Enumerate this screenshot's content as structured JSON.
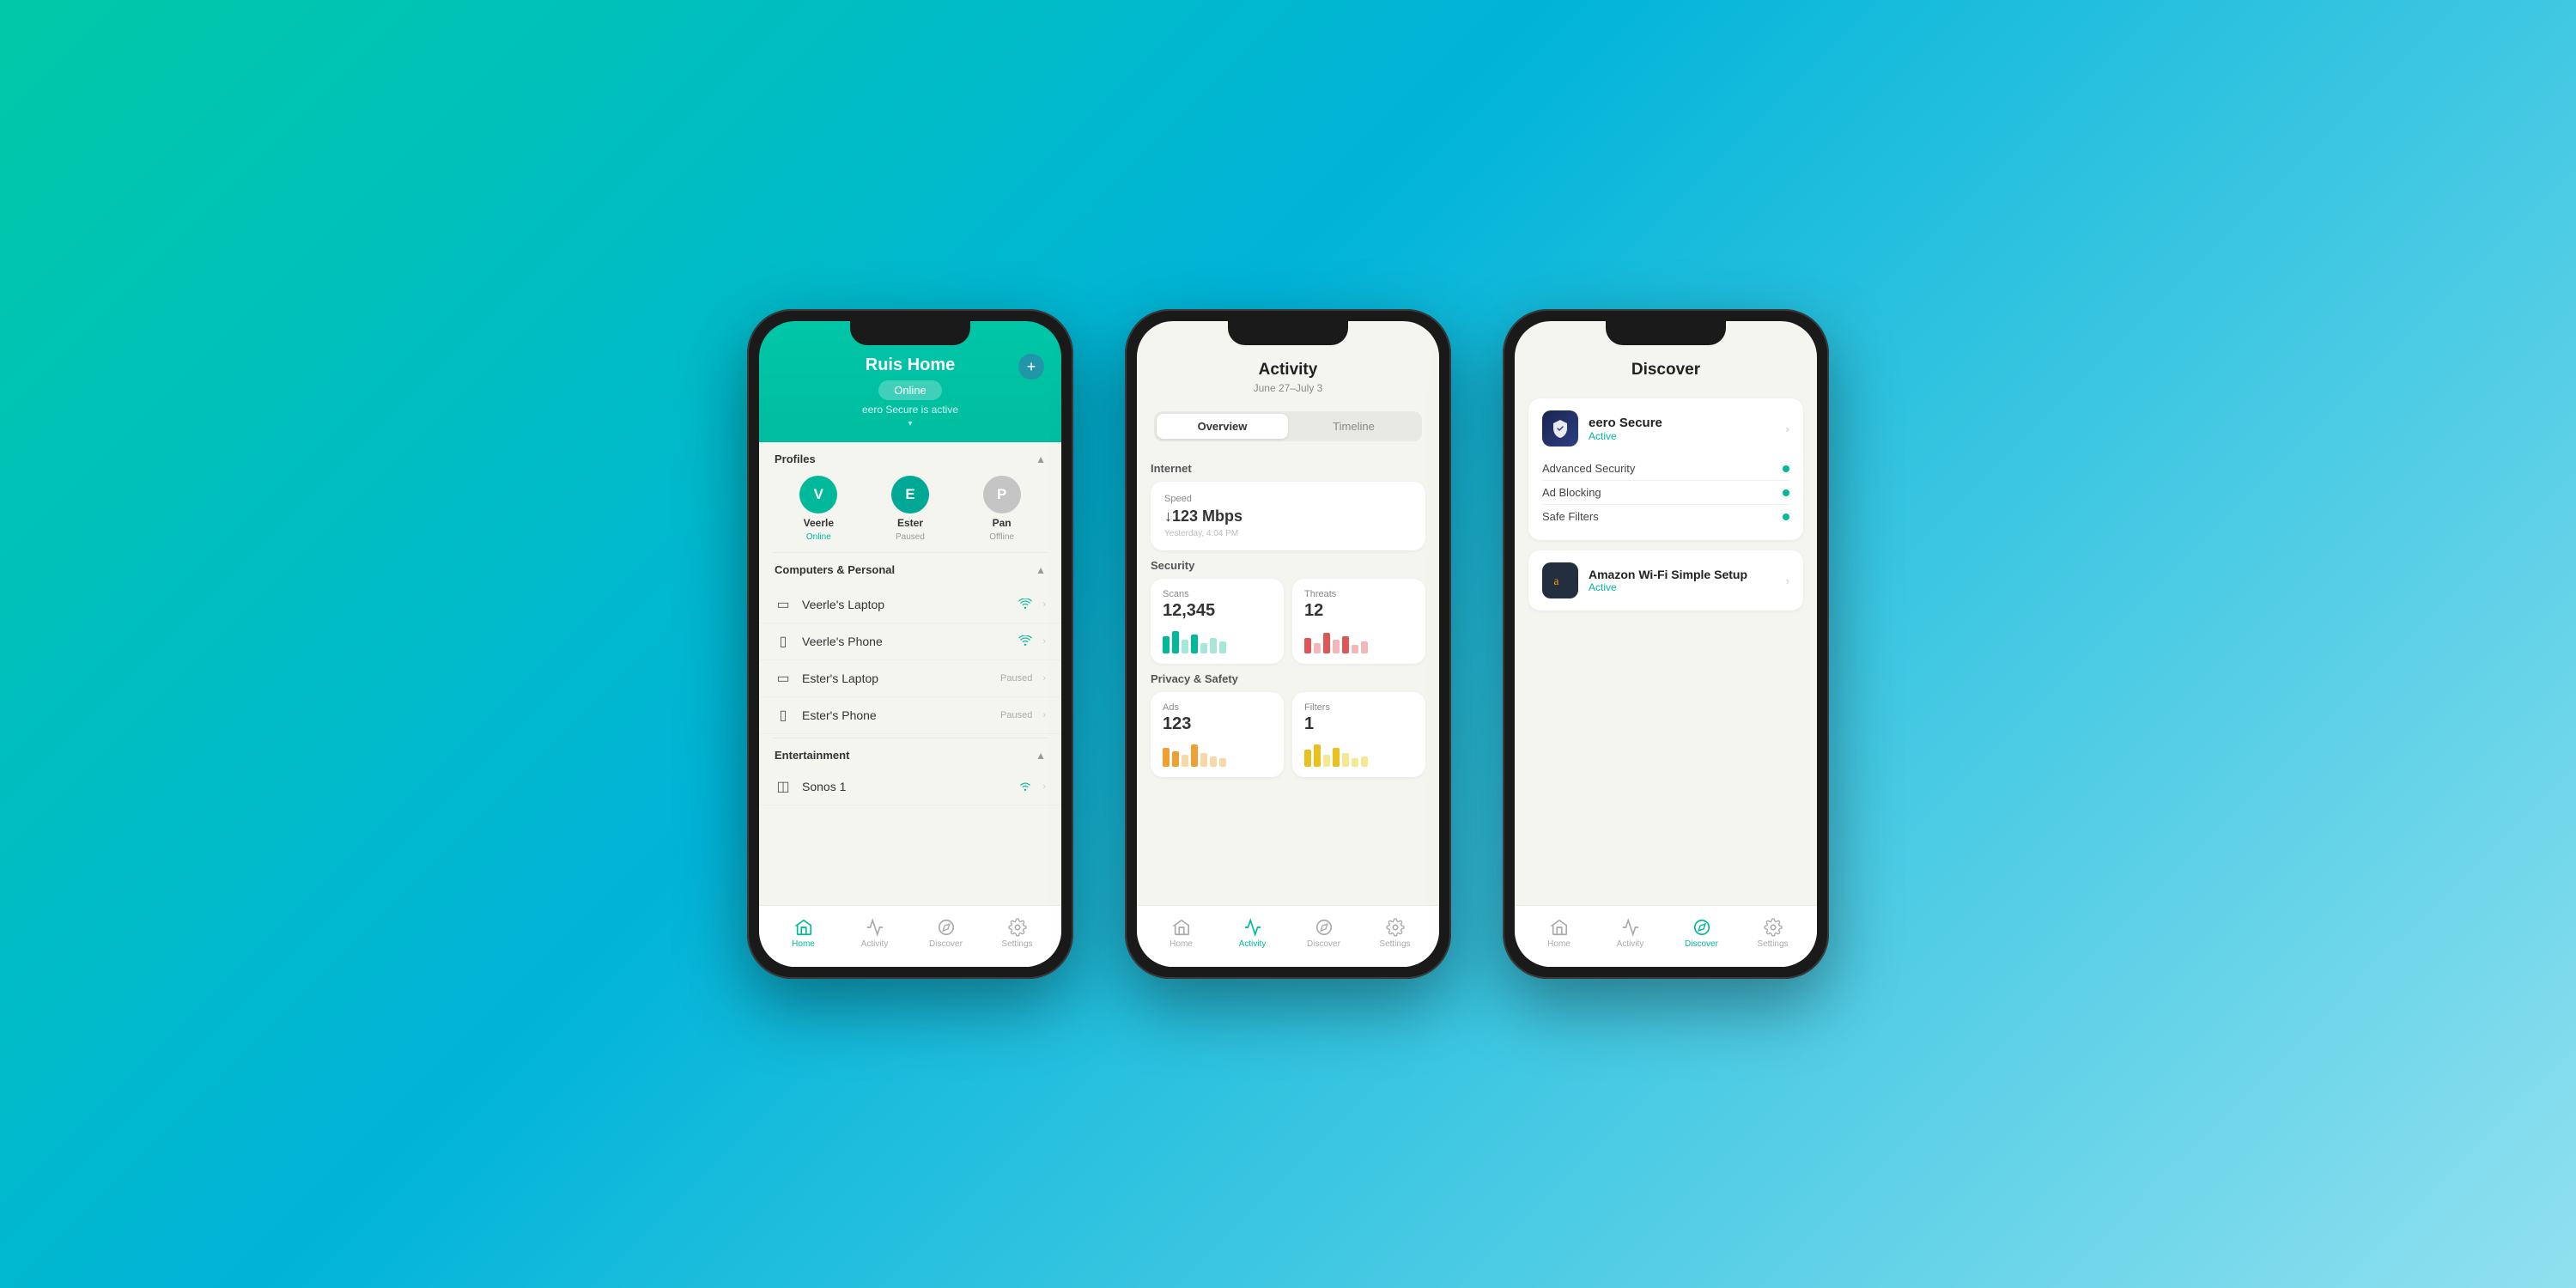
{
  "background": {
    "gradient_start": "#00c9a7",
    "gradient_end": "#90e0ef"
  },
  "phone1": {
    "title": "Ruis Home",
    "status": "Online",
    "secure_text": "eero Secure is active",
    "plus_btn": "+",
    "profiles_label": "Profiles",
    "profiles": [
      {
        "initial": "V",
        "name": "Veerle",
        "status": "Online",
        "color": "green"
      },
      {
        "initial": "E",
        "name": "Ester",
        "status": "Paused",
        "color": "teal"
      },
      {
        "initial": "P",
        "name": "Pan",
        "status": "Offline",
        "color": "gray"
      }
    ],
    "computers_label": "Computers & Personal",
    "devices": [
      {
        "icon": "💻",
        "name": "Veerle's Laptop",
        "status": "wifi",
        "type": "laptop"
      },
      {
        "icon": "📱",
        "name": "Veerle's Phone",
        "status": "wifi",
        "type": "phone"
      },
      {
        "icon": "💻",
        "name": "Ester's Laptop",
        "status": "Paused",
        "type": "laptop"
      },
      {
        "icon": "📱",
        "name": "Ester's Phone",
        "status": "Paused",
        "type": "phone"
      }
    ],
    "entertainment_label": "Entertainment",
    "entertainment_item": "Sonos 1",
    "nav": [
      {
        "icon": "⌂",
        "label": "Home",
        "active": true
      },
      {
        "icon": "♡",
        "label": "Activity",
        "active": false
      },
      {
        "icon": "◎",
        "label": "Discover",
        "active": false
      },
      {
        "icon": "⚙",
        "label": "Settings",
        "active": false
      }
    ]
  },
  "phone2": {
    "title": "Activity",
    "date_range": "June 27–July 3",
    "tabs": [
      {
        "label": "Overview",
        "active": true
      },
      {
        "label": "Timeline",
        "active": false
      }
    ],
    "internet_label": "Internet",
    "speed_label": "Speed",
    "speed_value": "↓123 Mbps",
    "speed_time": "Yesterday, 4:04 PM",
    "security_label": "Security",
    "scans_label": "Scans",
    "scans_value": "12,345",
    "threats_label": "Threats",
    "threats_value": "12",
    "privacy_label": "Privacy & Safety",
    "ads_label": "Ads",
    "ads_value": "123",
    "filters_label": "Filters",
    "filters_value": "1",
    "nav": [
      {
        "icon": "⌂",
        "label": "Home",
        "active": false
      },
      {
        "icon": "♡",
        "label": "Activity",
        "active": true
      },
      {
        "icon": "◎",
        "label": "Discover",
        "active": false
      },
      {
        "icon": "⚙",
        "label": "Settings",
        "active": false
      }
    ]
  },
  "phone3": {
    "title": "Discover",
    "eero_secure_name": "eero Secure",
    "eero_secure_status": "Active",
    "features": [
      {
        "label": "Advanced Security",
        "active": true
      },
      {
        "label": "Ad Blocking",
        "active": true
      },
      {
        "label": "Safe Filters",
        "active": true
      }
    ],
    "amazon_name": "Amazon Wi-Fi Simple Setup",
    "amazon_status": "Active",
    "nav": [
      {
        "icon": "⌂",
        "label": "Home",
        "active": false
      },
      {
        "icon": "♡",
        "label": "Activity",
        "active": false
      },
      {
        "icon": "◎",
        "label": "Discover",
        "active": true
      },
      {
        "icon": "⚙",
        "label": "Settings",
        "active": false
      }
    ]
  }
}
